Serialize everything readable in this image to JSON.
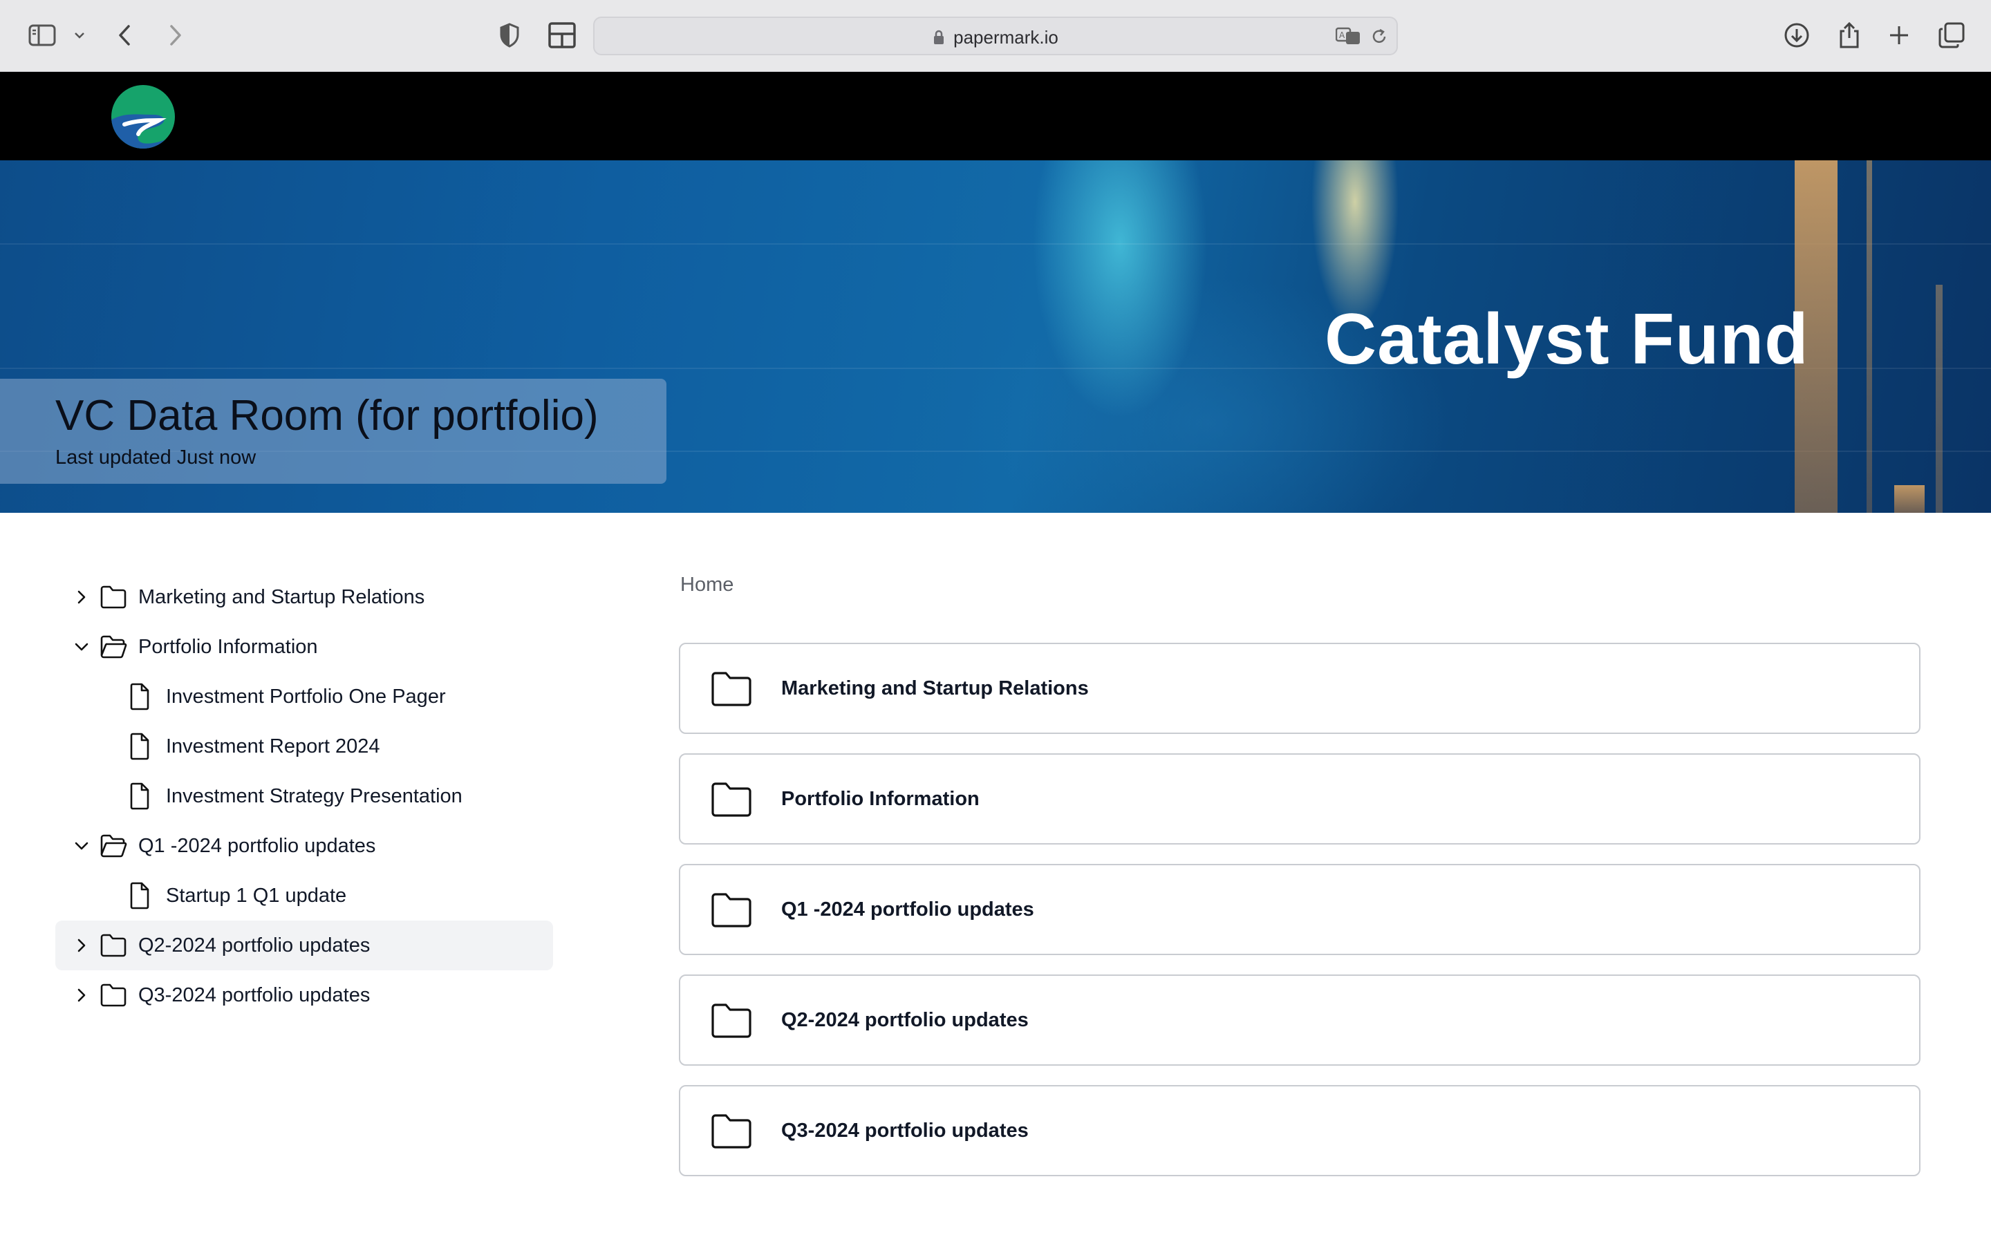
{
  "browser": {
    "url": "papermark.io",
    "icons": [
      "sidebar-icon",
      "chevron-down-icon",
      "back-icon",
      "forward-icon",
      "shield-icon",
      "layout-icon",
      "lock-icon",
      "translate-icon",
      "reload-icon",
      "download-icon",
      "share-icon",
      "new-tab-icon",
      "tabs-overview-icon"
    ]
  },
  "site": {
    "logo": "river-logo-icon"
  },
  "banner": {
    "brand_text": "Catalyst Fund",
    "title": "VC Data Room (for portfolio)",
    "subtitle": "Last updated Just now"
  },
  "tree": {
    "items": [
      {
        "label": "Marketing and Startup Relations",
        "type": "folder",
        "expanded": false
      },
      {
        "label": "Portfolio Information",
        "type": "folder",
        "expanded": true
      },
      {
        "label": "Investment Portfolio One Pager",
        "type": "file"
      },
      {
        "label": "Investment Report 2024",
        "type": "file"
      },
      {
        "label": "Investment Strategy Presentation",
        "type": "file"
      },
      {
        "label": "Q1 -2024 portfolio updates",
        "type": "folder",
        "expanded": true
      },
      {
        "label": "Startup 1 Q1 update",
        "type": "file"
      },
      {
        "label": "Q2-2024 portfolio updates",
        "type": "folder",
        "expanded": false,
        "active": true
      },
      {
        "label": "Q3-2024 portfolio updates",
        "type": "folder",
        "expanded": false
      }
    ]
  },
  "main": {
    "breadcrumb": "Home",
    "folders": [
      {
        "label": "Marketing and Startup Relations"
      },
      {
        "label": "Portfolio Information"
      },
      {
        "label": "Q1 -2024 portfolio updates"
      },
      {
        "label": "Q2-2024 portfolio updates"
      },
      {
        "label": "Q3-2024 portfolio updates"
      }
    ]
  },
  "colors": {
    "header_bg": "#000000",
    "active_row_bg": "#f2f3f5",
    "card_border": "#c9ccd1"
  }
}
